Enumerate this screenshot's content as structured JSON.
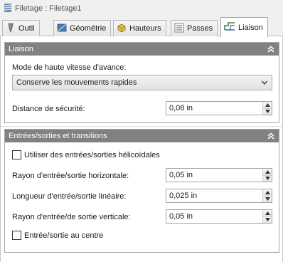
{
  "window": {
    "title": "Filetage : Filetage1",
    "title_icon": "thread-icon"
  },
  "tabs": [
    {
      "label": "Outil",
      "icon": "tool-icon",
      "active": false
    },
    {
      "label": "Géométrie",
      "icon": "geometry-icon",
      "active": false
    },
    {
      "label": "Hauteurs",
      "icon": "heights-icon",
      "active": false
    },
    {
      "label": "Passes",
      "icon": "passes-icon",
      "active": false
    },
    {
      "label": "Liaison",
      "icon": "linking-icon",
      "active": true
    }
  ],
  "liaison": {
    "header": "Liaison",
    "feed_mode_label": "Mode de haute vitesse d'avance:",
    "feed_mode_value": "Conserve les mouvements rapides",
    "safe_distance_label": "Distance de sécurité:",
    "safe_distance_value": "0,08 in"
  },
  "leads": {
    "header": "Entrées/sorties et transitions",
    "helical_label": "Utiliser des entrées/sorties hélicoïdales",
    "helical_checked": false,
    "horiz_radius_label": "Rayon d'entrée/sortie horizontale:",
    "horiz_radius_value": "0,05 in",
    "linear_length_label": "Longueur d'entrée/sortie linéaire:",
    "linear_length_value": "0,025 in",
    "vert_radius_label": "Rayon d'entrée/de sortie verticale:",
    "vert_radius_value": "0,05 in",
    "center_label": "Entrée/sortie au centre",
    "center_checked": false
  },
  "colors": {
    "panel_header": "#818181",
    "active_tab": "#ffffff",
    "background": "#f0f0f0"
  }
}
